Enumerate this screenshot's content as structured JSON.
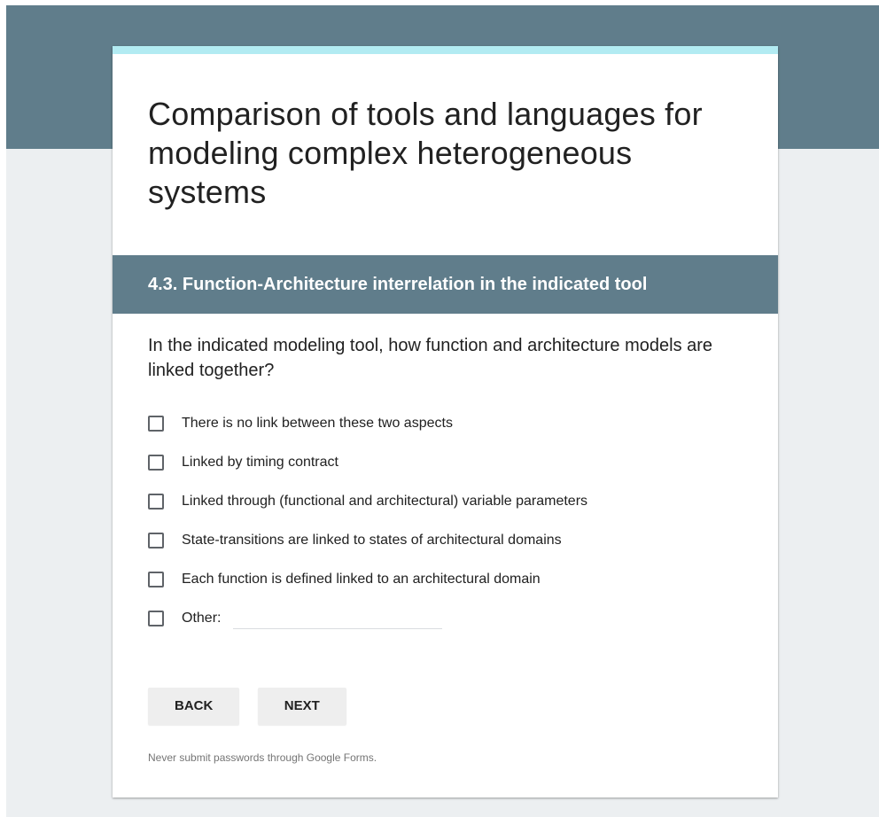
{
  "form": {
    "title": "Comparison of tools and languages for modeling complex heterogeneous systems"
  },
  "section": {
    "title": "4.3. Function-Architecture interrelation in the indicated tool"
  },
  "question": {
    "text": "In the indicated modeling tool, how function and architecture models are linked together?",
    "options": [
      {
        "label": "There is no link between these two aspects",
        "checked": false
      },
      {
        "label": "Linked by timing contract",
        "checked": false
      },
      {
        "label": "Linked through (functional and architectural) variable parameters",
        "checked": false
      },
      {
        "label": "State-transitions are linked to states of architectural domains",
        "checked": false
      },
      {
        "label": "Each function is defined linked to an architectural domain",
        "checked": false
      }
    ],
    "other": {
      "label": "Other:",
      "value": ""
    }
  },
  "navigation": {
    "back_label": "BACK",
    "next_label": "NEXT"
  },
  "footer": {
    "disclaimer": "Never submit passwords through Google Forms."
  },
  "colors": {
    "header": "#607d8b",
    "accent": "#b2ebf2",
    "background": "#eceff1"
  }
}
